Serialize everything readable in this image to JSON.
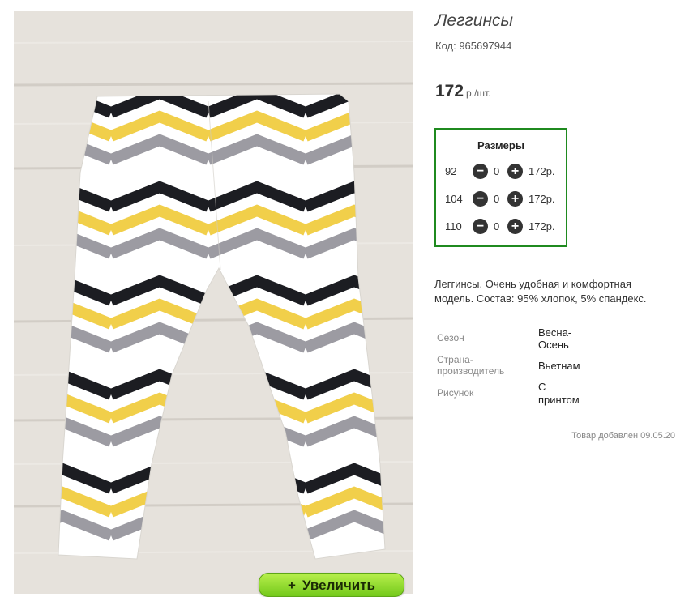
{
  "product": {
    "title": "Леггинсы",
    "code": "Код: 965697944",
    "price": "172",
    "price_unit": "р./шт.",
    "zoom_label": "Увеличить",
    "zoom_plus": "+"
  },
  "sizes": {
    "title": "Размеры",
    "rows": [
      {
        "size": "92",
        "qty": "0",
        "price": "172р."
      },
      {
        "size": "104",
        "qty": "0",
        "price": "172р."
      },
      {
        "size": "110",
        "qty": "0",
        "price": "172р."
      }
    ]
  },
  "description": "Леггинсы. Очень удобная и комфортная модель. Состав: 95% хлопок, 5% спандекс.",
  "attributes": [
    {
      "label_1": "Сезон",
      "label_2": "",
      "value_1": "Весна-",
      "value_2": "Осень"
    },
    {
      "label_1": "Страна-",
      "label_2": "производитель",
      "value_1": "Вьетнам",
      "value_2": ""
    },
    {
      "label_1": "Рисунок",
      "label_2": "",
      "value_1": "С",
      "value_2": "принтом"
    }
  ],
  "added": "Товар добавлен 09.05.20",
  "colors": {
    "frame": "#1f8a1f",
    "button": "#74c91b",
    "stripe_black": "#1c1d22",
    "stripe_yellow": "#f1cf4a",
    "stripe_gray": "#9c9ba2"
  },
  "icons": {
    "minus": "minus-circle-icon",
    "plus": "plus-circle-icon"
  }
}
